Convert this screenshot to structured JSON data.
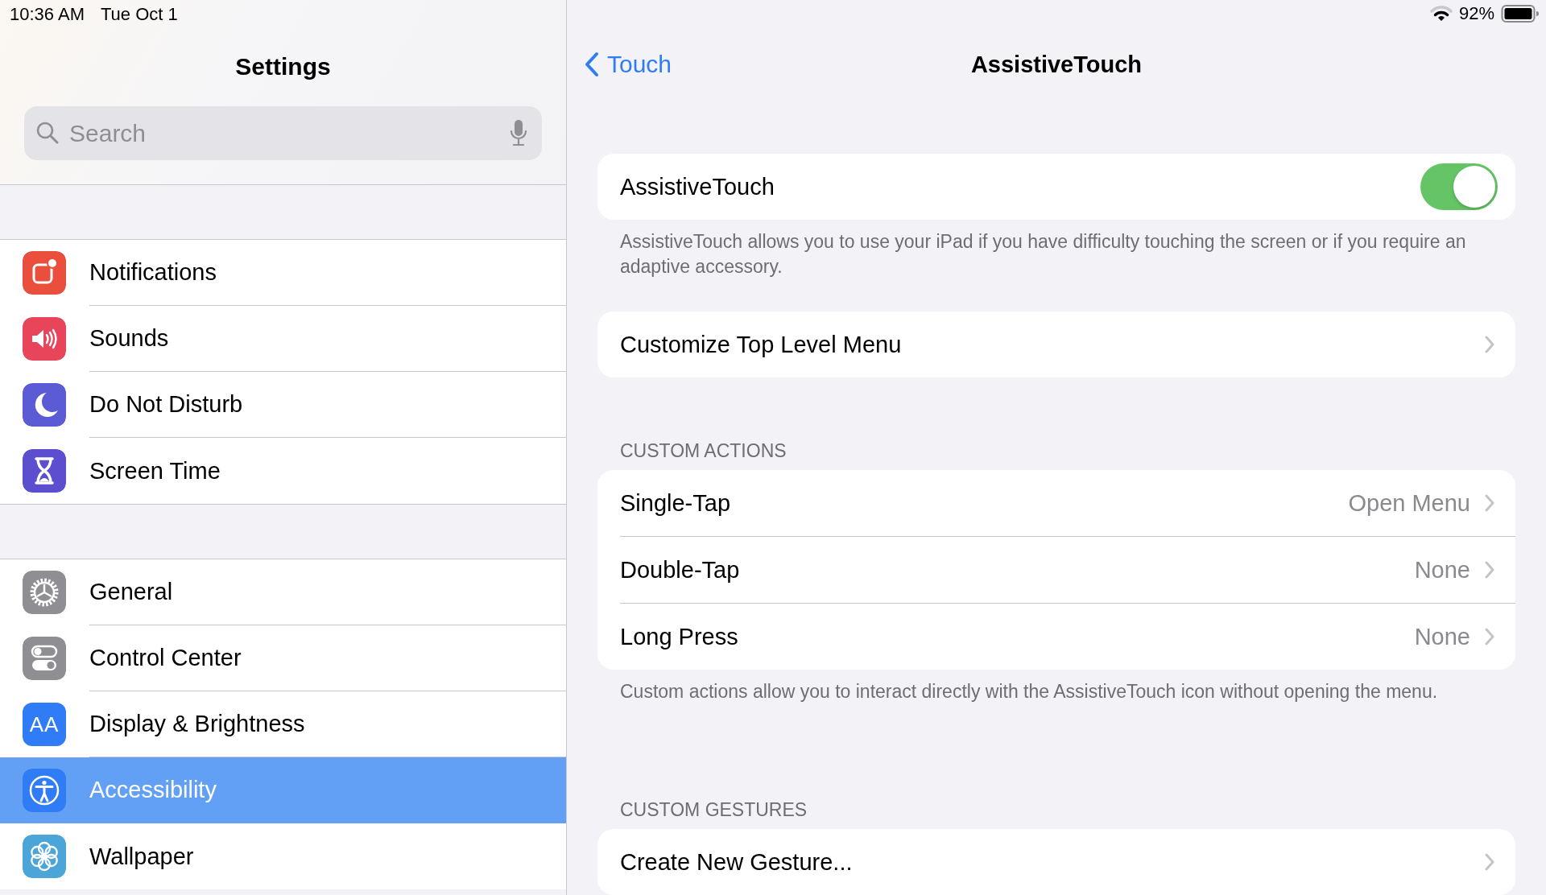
{
  "status_bar": {
    "time": "10:36 AM",
    "date": "Tue Oct 1",
    "battery": "92%"
  },
  "sidebar": {
    "title": "Settings",
    "search": {
      "placeholder": "Search"
    },
    "groups": [
      {
        "items": [
          {
            "label": "Notifications",
            "color": "#ea4e3d",
            "selected": false
          },
          {
            "label": "Sounds",
            "color": "#e8445a",
            "selected": false
          },
          {
            "label": "Do Not Disturb",
            "color": "#5b5bd6",
            "selected": false
          },
          {
            "label": "Screen Time",
            "color": "#5b4fd0",
            "selected": false
          }
        ]
      },
      {
        "items": [
          {
            "label": "General",
            "color": "#8e8e93",
            "selected": false
          },
          {
            "label": "Control Center",
            "color": "#8e8e93",
            "selected": false
          },
          {
            "label": "Display & Brightness",
            "icon_text": "AA",
            "color": "#2f7cf6",
            "selected": false
          },
          {
            "label": "Accessibility",
            "color": "#2f7cf6",
            "selected": true
          },
          {
            "label": "Wallpaper",
            "color": "#4ca5d8",
            "selected": false
          }
        ]
      }
    ]
  },
  "detail": {
    "back": "Touch",
    "title": "AssistiveTouch",
    "sections": [
      {
        "cells": [
          {
            "kind": "toggle",
            "label": "AssistiveTouch",
            "on": true
          }
        ],
        "footer": "AssistiveTouch allows you to use your iPad if you have difficulty touching the screen or if you require an adaptive accessory."
      },
      {
        "cells": [
          {
            "kind": "link",
            "label": "Customize Top Level Menu"
          }
        ]
      },
      {
        "header": "CUSTOM ACTIONS",
        "cells": [
          {
            "kind": "link",
            "label": "Single-Tap",
            "value": "Open Menu"
          },
          {
            "kind": "link",
            "label": "Double-Tap",
            "value": "None"
          },
          {
            "kind": "link",
            "label": "Long Press",
            "value": "None"
          }
        ],
        "footer": "Custom actions allow you to interact directly with the AssistiveTouch icon without opening the menu."
      },
      {
        "header": "CUSTOM GESTURES",
        "cells": [
          {
            "kind": "link",
            "label": "Create New Gesture..."
          }
        ]
      }
    ]
  }
}
